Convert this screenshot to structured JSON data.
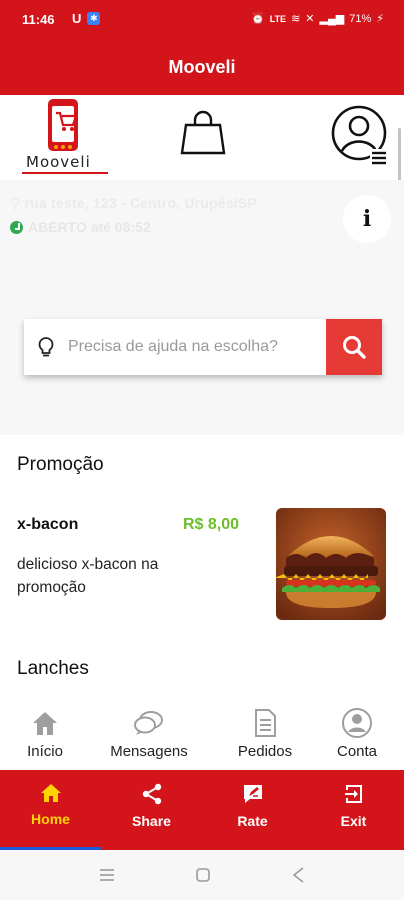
{
  "status_bar": {
    "time": "11:46",
    "battery": "71%"
  },
  "header": {
    "title": "Mooveli"
  },
  "logo": {
    "text": "Mooveli"
  },
  "store": {
    "address": "rua teste, 123 - Centro, Urupês/SP",
    "status": "ABERTO até 08:52"
  },
  "search": {
    "placeholder": "Precisa de ajuda na escolha?"
  },
  "sections": {
    "promo": "Promoção",
    "lanches": "Lanches"
  },
  "promo_product": {
    "name": "x-bacon",
    "price": "R$ 8,00",
    "description": "delicioso x-bacon na promoção"
  },
  "inner_tabs": [
    {
      "label": "Início",
      "icon": "home-icon"
    },
    {
      "label": "Mensagens",
      "icon": "chat-icon"
    },
    {
      "label": "Pedidos",
      "icon": "document-icon"
    },
    {
      "label": "Conta",
      "icon": "user-icon"
    }
  ],
  "bottom_nav": [
    {
      "label": "Home",
      "icon": "home-icon"
    },
    {
      "label": "Share",
      "icon": "share-icon"
    },
    {
      "label": "Rate",
      "icon": "rate-icon"
    },
    {
      "label": "Exit",
      "icon": "exit-icon"
    }
  ],
  "colors": {
    "primary": "#d3141a",
    "accent_yellow": "#ffd400",
    "price_green": "#6bbf2a",
    "search_button": "#e63a36"
  }
}
